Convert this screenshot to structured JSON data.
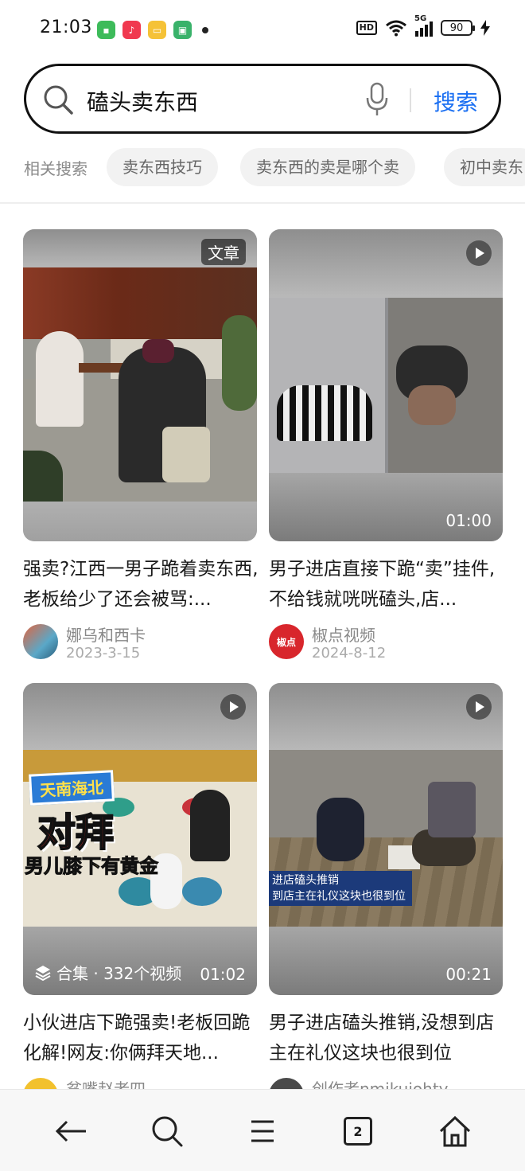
{
  "status_bar": {
    "time": "21:03",
    "hd": "HD",
    "network": "5G",
    "battery": "90",
    "apps": [
      {
        "icon": "messages-app-icon",
        "color": "#3dbb5a"
      },
      {
        "icon": "music-app-icon",
        "color": "#f0394f"
      },
      {
        "icon": "notes-app-icon",
        "color": "#f5c237"
      },
      {
        "icon": "android-app-icon",
        "color": "#39b26a"
      }
    ]
  },
  "search": {
    "query": "磕头卖东西",
    "button_label": "搜索"
  },
  "related": {
    "label": "相关搜索",
    "chips": [
      "卖东西技巧",
      "卖东西的卖是哪个卖",
      "初中卖东"
    ]
  },
  "cards": [
    {
      "title": "强卖?江西一男子跪着卖东西,老板给少了还会被骂:...",
      "badge": "文章",
      "author": "娜乌和西卡",
      "date": "2023-3-15"
    },
    {
      "title": "男子进店直接下跪“卖”挂件,不给钱就咣咣磕头,店...",
      "duration": "01:00",
      "author": "椒点视频",
      "avatar_text": "椒点",
      "date": "2024-8-12"
    },
    {
      "title": "小伙进店下跪强卖!老板回跪化解!网友:你俩拜天地...",
      "duration": "01:02",
      "collection": "合集 · 332个视频",
      "overlay_lines": [
        "天南海北",
        "对拜",
        "男儿膝下有黄金"
      ],
      "author": "贫嘴赵老四"
    },
    {
      "title": "男子进店磕头推销,没想到店主在礼仪这块也很到位",
      "duration": "00:21",
      "overlay_lines": [
        "进店磕头推销",
        "到店主在礼仪这块也很到位"
      ],
      "author": "创作者nmikuiohty"
    }
  ],
  "bottom_nav": {
    "tab_count": "2"
  },
  "colors": {
    "accent": "#1a6ff2",
    "chip_bg": "#f2f2f2",
    "muted_text": "#8a8a8a"
  }
}
